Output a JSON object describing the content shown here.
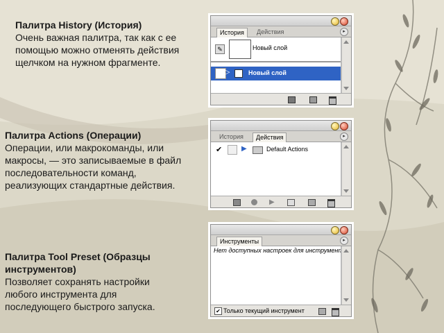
{
  "colors": {
    "background": "#dcd8c8",
    "selection": "#2f63c4"
  },
  "history_section": {
    "heading": "Палитра History (История)",
    "description": "Очень важная палитра, так как с ее помощью можно отменять действия щелчком на нужном фрагменте."
  },
  "actions_section": {
    "heading": "Палитра Actions (Операции)",
    "description": "Операции, или макрокоманды, или макросы, — это записываемые в файл последовательности команд, реализующих стандартные действия."
  },
  "toolpreset_section": {
    "heading": "Палитра Tool Preset (Образцы инструментов)",
    "description": "Позволяет сохранять настройки любого инструмента для последующего быстрого запуска."
  },
  "history_palette": {
    "tabs": [
      "История",
      "Действия"
    ],
    "snapshot_label": "Новый слой",
    "state_label": "Новый слой"
  },
  "actions_palette": {
    "tabs": [
      "История",
      "Действия"
    ],
    "set_label": "Default Actions"
  },
  "tools_palette": {
    "tab": "Инструменты",
    "empty_message": "Нет доступных настроек для инструмента.",
    "checkbox_label": "Только текущий инструмент"
  }
}
